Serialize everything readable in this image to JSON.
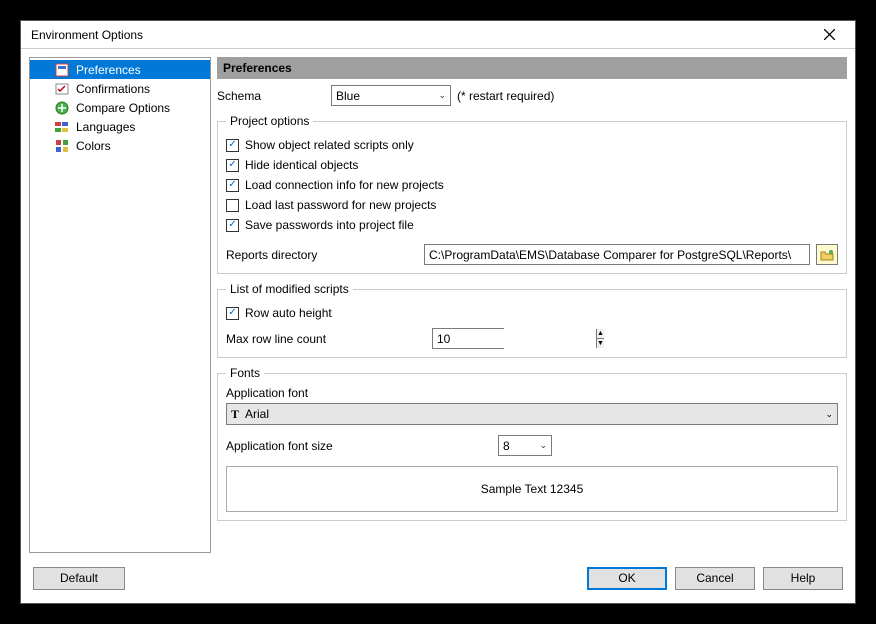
{
  "window": {
    "title": "Environment Options"
  },
  "tree": {
    "items": [
      {
        "label": "Preferences",
        "selected": true
      },
      {
        "label": "Confirmations",
        "selected": false
      },
      {
        "label": "Compare Options",
        "selected": false
      },
      {
        "label": "Languages",
        "selected": false
      },
      {
        "label": "Colors",
        "selected": false
      }
    ]
  },
  "header": "Preferences",
  "schema": {
    "label": "Schema",
    "value": "Blue",
    "note": "(* restart required)"
  },
  "project_options": {
    "legend": "Project options",
    "cb1": {
      "label": "Show object related scripts only",
      "checked": true
    },
    "cb2": {
      "label": "Hide identical objects",
      "checked": true
    },
    "cb3": {
      "label": "Load connection info for new projects",
      "checked": true
    },
    "cb4": {
      "label": "Load last password for new projects",
      "checked": false
    },
    "cb5": {
      "label": "Save passwords into project file",
      "checked": true
    },
    "reports_label": "Reports directory",
    "reports_path": "C:\\ProgramData\\EMS\\Database Comparer for PostgreSQL\\Reports\\"
  },
  "modified_scripts": {
    "legend": "List of modified scripts",
    "cb": {
      "label": "Row auto height",
      "checked": true
    },
    "max_label": "Max row line count",
    "max_value": "10"
  },
  "fonts": {
    "legend": "Fonts",
    "app_font_label": "Application font",
    "app_font_value": "Arial",
    "size_label": "Application font size",
    "size_value": "8",
    "sample": "Sample Text 12345"
  },
  "buttons": {
    "default": "Default",
    "ok": "OK",
    "cancel": "Cancel",
    "help": "Help"
  }
}
